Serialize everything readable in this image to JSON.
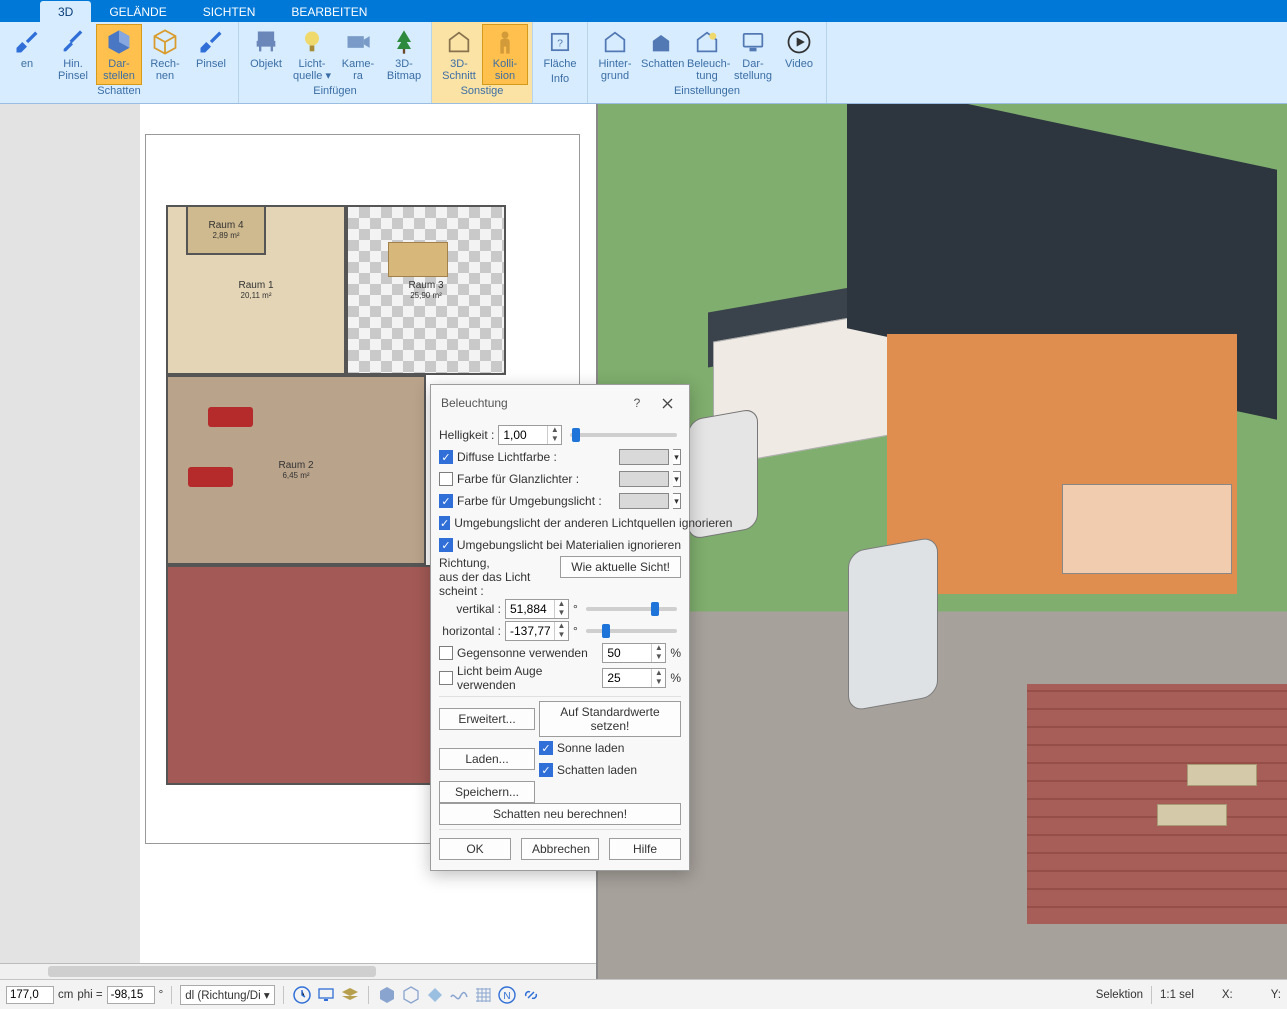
{
  "tabs": {
    "t0": "3D",
    "t1": "GELÄNDE",
    "t2": "SICHTEN",
    "t3": "BEARBEITEN"
  },
  "ribbon": {
    "g_schatten": {
      "label": "Schatten",
      "b0a": "en",
      "b0b": "",
      "b1a": "Hin.",
      "b1b": "Pinsel",
      "b2a": "Dar-",
      "b2b": "stellen",
      "b3a": "Rech-",
      "b3b": "nen",
      "b4a": "Pinsel",
      "b4b": ""
    },
    "g_einfuegen": {
      "label": "Einfügen",
      "b0a": "Objekt",
      "b0b": "",
      "b1a": "Licht-",
      "b1b": "quelle ▾",
      "b2a": "Kame-",
      "b2b": "ra",
      "b3a": "3D-",
      "b3b": "Bitmap"
    },
    "g_sonstige": {
      "label": "Sonstige",
      "b0a": "3D-",
      "b0b": "Schnitt",
      "b1a": "Kolli-",
      "b1b": "sion"
    },
    "g_info": {
      "label": "Info",
      "b0a": "Fläche",
      "b0b": ""
    },
    "g_einst": {
      "label": "Einstellungen",
      "b0a": "Hinter-",
      "b0b": "grund",
      "b1a": "Schatten",
      "b1b": "",
      "b2a": "Beleuch-",
      "b2b": "tung",
      "b3a": "Dar-",
      "b3b": "stellung",
      "b4a": "Video",
      "b4b": ""
    }
  },
  "plan": {
    "r1": "Raum 1",
    "r1s": "20,11 m²",
    "r2": "Raum 2",
    "r2s": "6,45 m²",
    "r3": "Raum 3",
    "r3s": "25,90 m²",
    "r4": "Raum 4",
    "r4s": "2,89 m²"
  },
  "dialog": {
    "title": "Beleuchtung",
    "help": "?",
    "helligkeit": "Helligkeit :",
    "helligkeit_val": "1,00",
    "diffuse": "Diffuse Lichtfarbe :",
    "glanz": "Farbe für Glanzlichter :",
    "umgebung": "Farbe für Umgebungslicht :",
    "ignore1": "Umgebungslicht der anderen Lichtquellen ignorieren",
    "ignore2": "Umgebungslicht bei Materialien ignorieren",
    "richtung_a": "Richtung,",
    "richtung_b": "aus der das Licht scheint :",
    "wie_sicht": "Wie aktuelle Sicht!",
    "vertikal": "vertikal :",
    "vertikal_val": "51,884",
    "horizontal": "horizontal :",
    "horizontal_val": "-137,773",
    "gegensonne": "Gegensonne verwenden",
    "gegensonne_val": "50",
    "pct": "%",
    "licht_auge": "Licht beim Auge verwenden",
    "licht_auge_val": "25",
    "erweitert": "Erweitert...",
    "standard": "Auf Standardwerte setzen!",
    "laden": "Laden...",
    "sonne_laden": "Sonne laden",
    "schatten_laden": "Schatten laden",
    "speichern": "Speichern...",
    "neuberechnen": "Schatten neu berechnen!",
    "ok": "OK",
    "abbr": "Abbrechen",
    "hilfe": "Hilfe"
  },
  "status": {
    "v1": "177,0",
    "unit": "cm",
    "phi": "phi =",
    "v2": "-98,15",
    "deg": "°",
    "combo": "dl (Richtung/Di ▾",
    "selektion": "Selektion",
    "sel": "1:1 sel",
    "x": "X:",
    "y": "Y:"
  }
}
